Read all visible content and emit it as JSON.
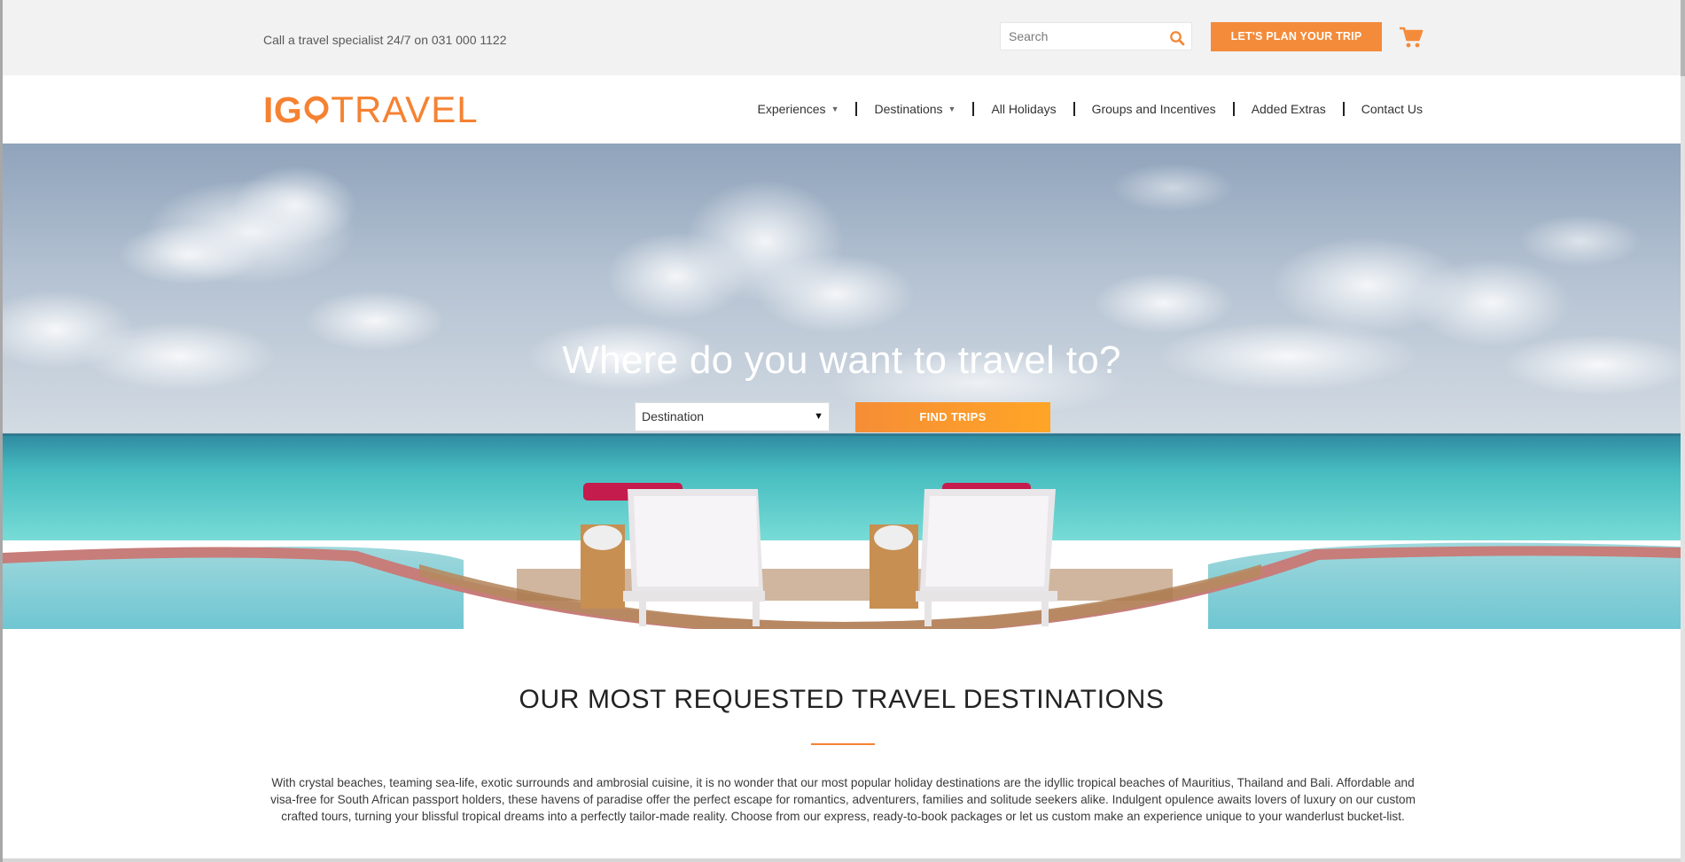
{
  "topbar": {
    "phone_text": "Call a travel specialist 24/7 on 031 000 1122",
    "search_placeholder": "Search",
    "plan_button": "LET'S PLAN YOUR TRIP",
    "icons": {
      "search": "search-icon",
      "cart": "cart-icon"
    },
    "accent_color": "#f48b3a"
  },
  "header": {
    "logo_left": "IG",
    "logo_right": "TRAVEL",
    "nav": [
      {
        "label": "Experiences",
        "has_dropdown": true
      },
      {
        "label": "Destinations",
        "has_dropdown": true
      },
      {
        "label": "All Holidays",
        "has_dropdown": false
      },
      {
        "label": "Groups and Incentives",
        "has_dropdown": false
      },
      {
        "label": "Added Extras",
        "has_dropdown": false
      },
      {
        "label": "Contact Us",
        "has_dropdown": false
      }
    ],
    "dropdown_glyph": "▼"
  },
  "hero": {
    "title": "Where do you want to travel to?",
    "destination_select": {
      "selected": "Destination",
      "caret": "▼"
    },
    "find_button": "FIND TRIPS"
  },
  "content": {
    "section_title": "OUR MOST REQUESTED TRAVEL DESTINATIONS",
    "intro": "With crystal beaches, teaming sea-life, exotic surrounds and ambrosial cuisine, it is no wonder that our most popular holiday destinations are the idyllic tropical beaches of Mauritius, Thailand and Bali. Affordable and visa-free for South African passport holders, these havens of paradise offer the perfect escape for romantics, adventurers, families and solitude seekers alike. Indulgent opulence awaits lovers of luxury on our custom crafted tours, turning your blissful tropical dreams into a perfectly tailor-made reality. Choose from our express, ready-to-book packages or let us custom make an experience unique to your wanderlust bucket-list."
  }
}
